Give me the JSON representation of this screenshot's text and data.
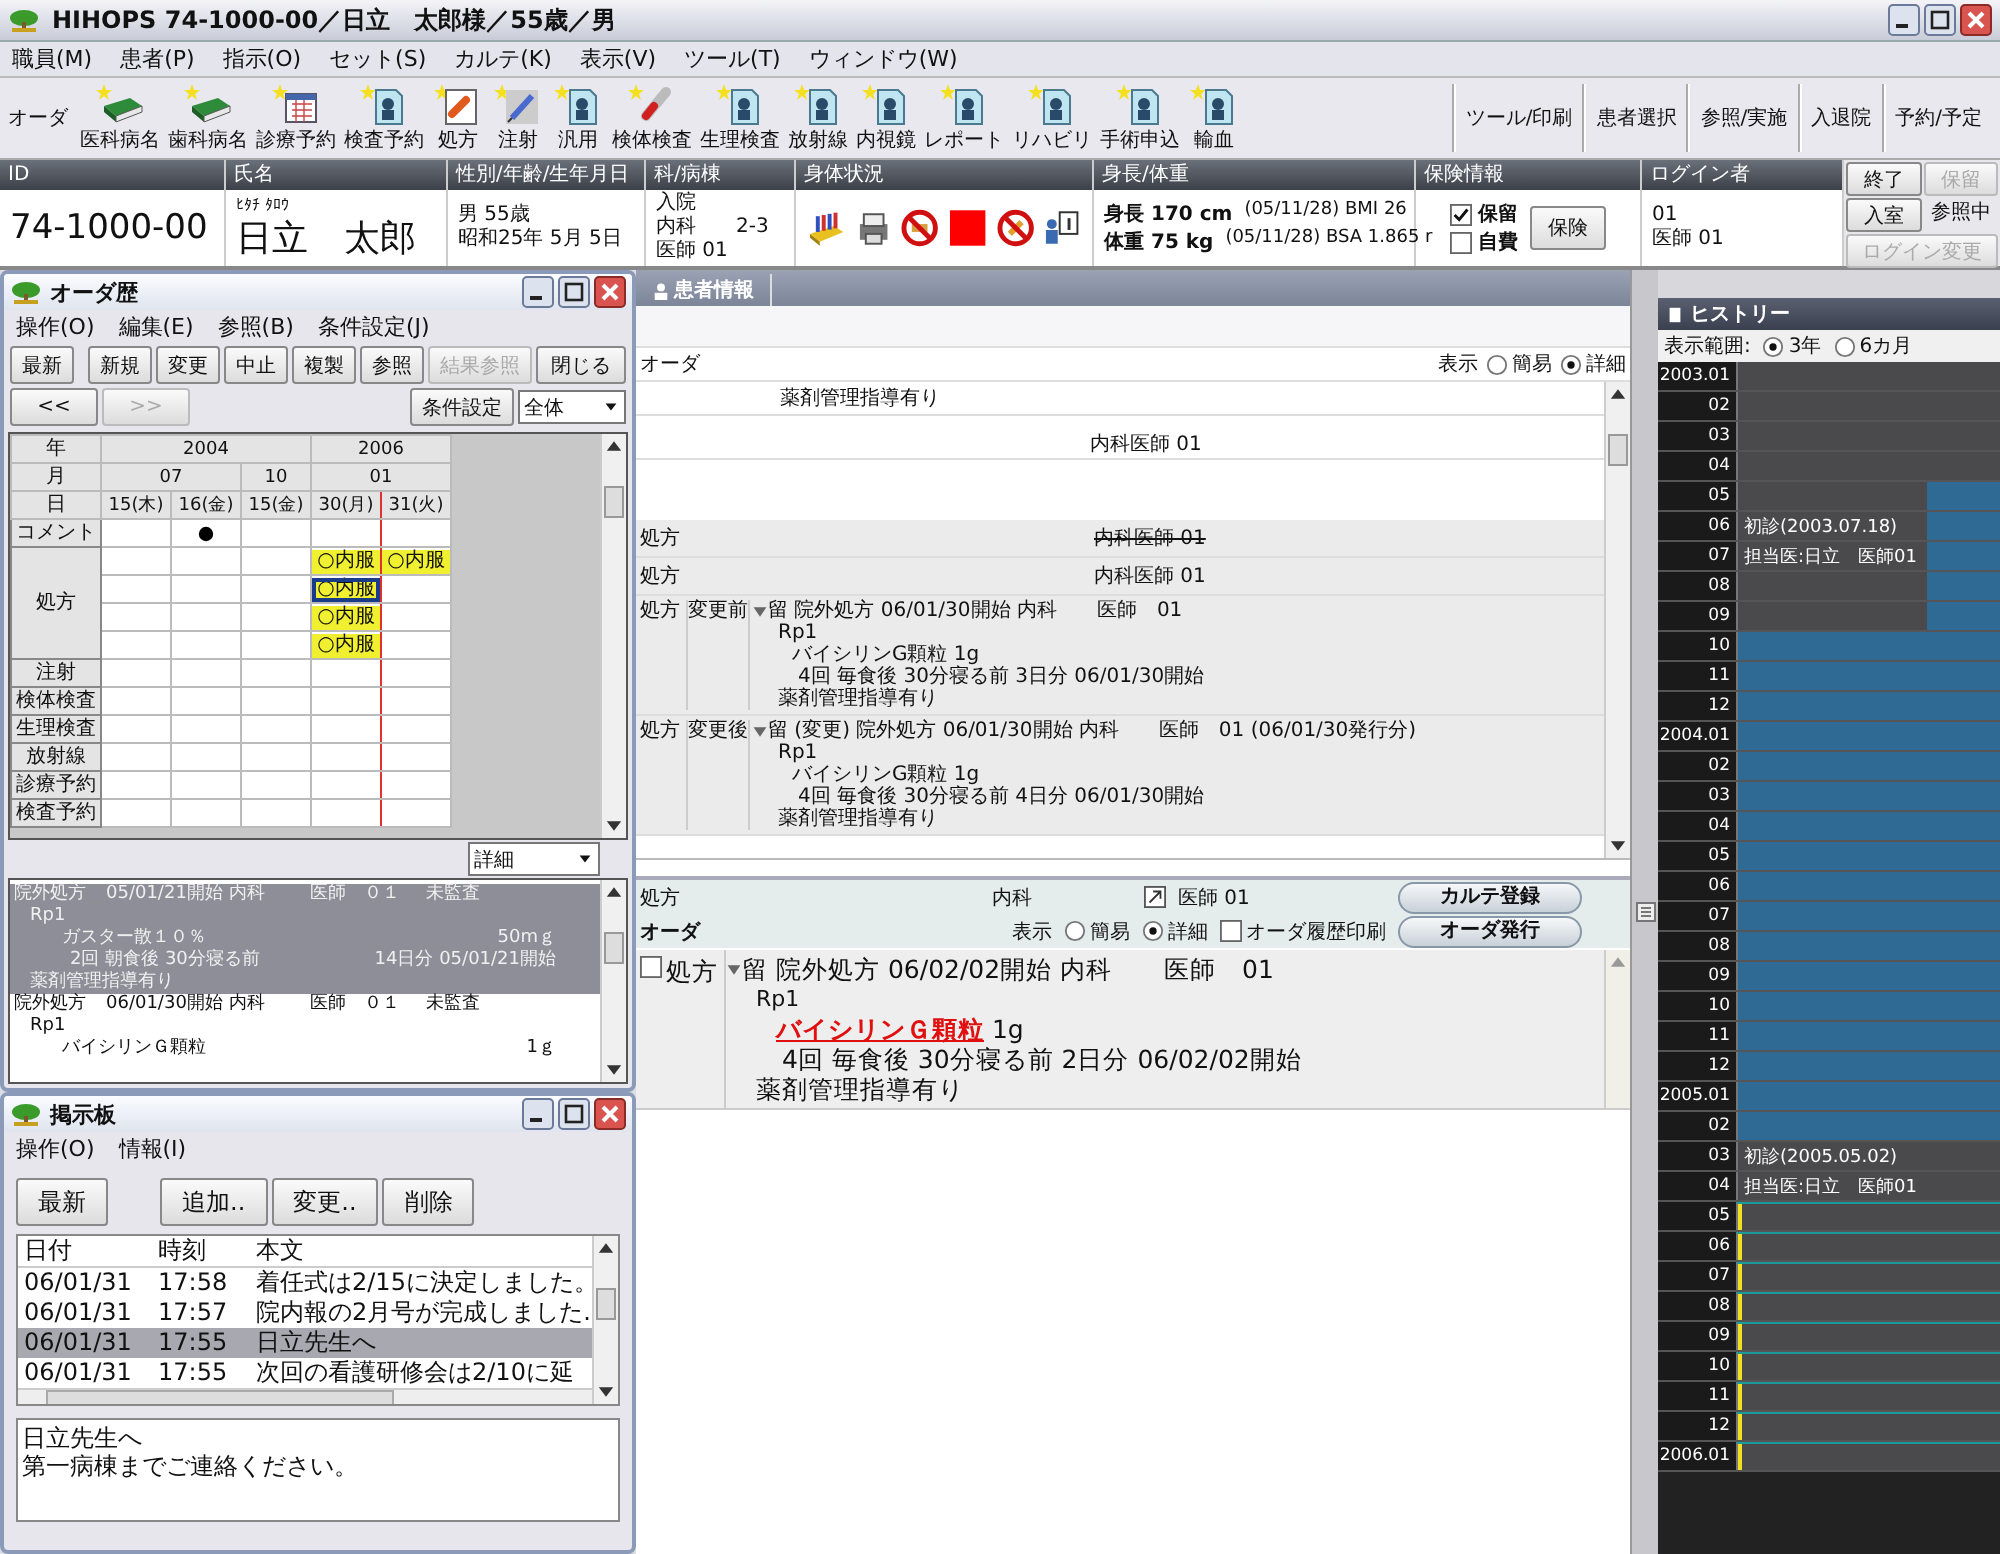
{
  "window": {
    "title": "HIHOPS 74-1000-00／日立　太郎様／55歳／男"
  },
  "menu": [
    "職員(M)",
    "患者(P)",
    "指示(O)",
    "セット(S)",
    "カルテ(K)",
    "表示(V)",
    "ツール(T)",
    "ウィンドウ(W)"
  ],
  "toolbar": {
    "label": "オーダ",
    "items": [
      "医科病名",
      "歯科病名",
      "診療予約",
      "検査予約",
      "処方",
      "注射",
      "汎用",
      "検体検査",
      "生理検査",
      "放射線",
      "内視鏡",
      "レポート",
      "リハビリ",
      "手術申込",
      "輸血"
    ],
    "buttons": [
      "ツール/印刷",
      "患者選択",
      "参照/実施",
      "入退院",
      "予約/予定"
    ]
  },
  "patient": {
    "id": {
      "heading": "ID",
      "value": "74-1000-00"
    },
    "name": {
      "heading": "氏名",
      "kana": "ﾋﾀﾁ ﾀﾛｳ",
      "value": "日立　太郎"
    },
    "profile": {
      "heading": "性別/年齢/生年月日",
      "lines": [
        "男 55歳",
        "昭和25年 5月 5日"
      ]
    },
    "ward": {
      "heading": "科/病棟",
      "lines": [
        "入院",
        "内科　　2-3",
        "医師 01"
      ]
    },
    "status": {
      "heading": "身体状況"
    },
    "body": {
      "heading": "身長/体重",
      "rows": [
        {
          "label": "身長 170 cm",
          "detail": "(05/11/28) BMI 26"
        },
        {
          "label": "体重 75 kg",
          "detail": "(05/11/28) BSA 1.865 r"
        }
      ]
    },
    "insurance": {
      "heading": "保険情報",
      "checks": [
        {
          "label": "保留",
          "checked": true
        },
        {
          "label": "自費",
          "checked": false
        }
      ],
      "button": "保険"
    },
    "login": {
      "heading": "ログイン者",
      "lines": [
        "01",
        "医師 01"
      ],
      "buttons": [
        {
          "label": "終了",
          "kind": "button",
          "disabled": false
        },
        {
          "label": "保留",
          "kind": "button",
          "disabled": true
        },
        {
          "label": "入室",
          "kind": "button",
          "disabled": false
        },
        {
          "label": "参照中",
          "kind": "text",
          "disabled": false
        },
        {
          "label": "ログイン変更",
          "kind": "button",
          "disabled": true
        }
      ]
    }
  },
  "order_history": {
    "title": "オーダ歴",
    "menu": [
      "操作(O)",
      "編集(E)",
      "参照(B)",
      "条件設定(J)"
    ],
    "buttons": [
      {
        "label": "最新",
        "disabled": false
      },
      {
        "label": "新規",
        "disabled": false
      },
      {
        "label": "変更",
        "disabled": false
      },
      {
        "label": "中止",
        "disabled": false
      },
      {
        "label": "複製",
        "disabled": false
      },
      {
        "label": "参照",
        "disabled": false
      },
      {
        "label": "結果参照",
        "disabled": true
      },
      {
        "label": "閉じる",
        "disabled": false
      }
    ],
    "nav": [
      {
        "label": "<<",
        "disabled": false
      },
      {
        "label": ">>",
        "disabled": true
      }
    ],
    "filter_button": "条件設定",
    "filter": "全体",
    "grid": {
      "header_labels": [
        "年",
        "月",
        "日"
      ],
      "years": [
        {
          "label": "2004",
          "months": [
            {
              "label": "07",
              "days": [
                {
                  "label": "15(木)",
                  "marked": false
                },
                {
                  "label": "16(金)",
                  "marked": false
                }
              ]
            },
            {
              "label": "10",
              "days": [
                {
                  "label": "15(金)",
                  "marked": false
                }
              ]
            }
          ]
        },
        {
          "label": "2006",
          "months": [
            {
              "label": "01",
              "days": [
                {
                  "label": "30(月)",
                  "marked": true
                },
                {
                  "label": "31(火)",
                  "marked": false
                }
              ]
            }
          ]
        }
      ],
      "rows": [
        {
          "label": "コメント",
          "lines": [
            [
              {
                "kind": "empty"
              },
              {
                "kind": "dot"
              },
              {
                "kind": "empty"
              },
              {
                "kind": "empty"
              },
              {
                "kind": "empty"
              }
            ]
          ]
        },
        {
          "label": "処方",
          "lines": [
            [
              {
                "kind": "empty"
              },
              {
                "kind": "empty"
              },
              {
                "kind": "empty"
              },
              {
                "kind": "order",
                "text": "○内服",
                "selected": false
              },
              {
                "kind": "order",
                "text": "○内服",
                "selected": false
              }
            ],
            [
              {
                "kind": "empty"
              },
              {
                "kind": "empty"
              },
              {
                "kind": "empty"
              },
              {
                "kind": "order",
                "text": "○内服",
                "selected": true
              },
              {
                "kind": "empty"
              }
            ],
            [
              {
                "kind": "empty"
              },
              {
                "kind": "empty"
              },
              {
                "kind": "empty"
              },
              {
                "kind": "order",
                "text": "○内服",
                "selected": false
              },
              {
                "kind": "empty"
              }
            ],
            [
              {
                "kind": "empty"
              },
              {
                "kind": "empty"
              },
              {
                "kind": "empty"
              },
              {
                "kind": "order",
                "text": "○内服",
                "selected": false
              },
              {
                "kind": "empty"
              }
            ]
          ]
        },
        {
          "label": "注射",
          "lines": [
            [
              {
                "kind": "empty"
              },
              {
                "kind": "empty"
              },
              {
                "kind": "empty"
              },
              {
                "kind": "empty"
              },
              {
                "kind": "empty"
              }
            ]
          ]
        },
        {
          "label": "検体検査",
          "lines": [
            [
              {
                "kind": "empty"
              },
              {
                "kind": "empty"
              },
              {
                "kind": "empty"
              },
              {
                "kind": "empty"
              },
              {
                "kind": "empty"
              }
            ]
          ]
        },
        {
          "label": "生理検査",
          "lines": [
            [
              {
                "kind": "empty"
              },
              {
                "kind": "empty"
              },
              {
                "kind": "empty"
              },
              {
                "kind": "empty"
              },
              {
                "kind": "empty"
              }
            ]
          ]
        },
        {
          "label": "放射線",
          "lines": [
            [
              {
                "kind": "empty"
              },
              {
                "kind": "empty"
              },
              {
                "kind": "empty"
              },
              {
                "kind": "empty"
              },
              {
                "kind": "empty"
              }
            ]
          ]
        },
        {
          "label": "診療予約",
          "lines": [
            [
              {
                "kind": "empty"
              },
              {
                "kind": "empty"
              },
              {
                "kind": "empty"
              },
              {
                "kind": "empty"
              },
              {
                "kind": "empty"
              }
            ]
          ]
        },
        {
          "label": "検査予約",
          "lines": [
            [
              {
                "kind": "empty"
              },
              {
                "kind": "empty"
              },
              {
                "kind": "empty"
              },
              {
                "kind": "empty"
              },
              {
                "kind": "empty"
              }
            ]
          ]
        }
      ]
    },
    "view": "詳細",
    "details": [
      {
        "selected": true,
        "lines": [
          {
            "kind": "head",
            "cells": [
              "院外処方",
              "05/01/21開始 内科",
              "医師　０１",
              "未監査"
            ]
          },
          {
            "kind": "rp",
            "text": "Rp1"
          },
          {
            "kind": "drug",
            "text": "ガスター散１０％",
            "aside": "50mｇ"
          },
          {
            "kind": "usage",
            "text": "2回 朝食後 30分寝る前",
            "aside": "14日分 05/01/21開始"
          },
          {
            "kind": "note",
            "text": "薬剤管理指導有り"
          }
        ]
      },
      {
        "selected": false,
        "lines": [
          {
            "kind": "head",
            "cells": [
              "院外処方",
              "06/01/30開始 内科",
              "医師　０１",
              "未監査"
            ]
          },
          {
            "kind": "rp",
            "text": "Rp1"
          },
          {
            "kind": "drug",
            "text": "バイシリンＧ顆粒",
            "aside": "1ｇ"
          }
        ]
      }
    ]
  },
  "bulletin": {
    "title": "掲示板",
    "menu": [
      "操作(O)",
      "情報(I)"
    ],
    "buttons": [
      "最新",
      "追加..",
      "変更..",
      "削除"
    ],
    "columns": [
      "日付",
      "時刻",
      "本文"
    ],
    "rows": [
      {
        "date": "06/01/31",
        "time": "17:58",
        "text": "着任式は2/15に決定しました。",
        "selected": false
      },
      {
        "date": "06/01/31",
        "time": "17:57",
        "text": "院内報の2月号が完成しました.",
        "selected": false
      },
      {
        "date": "06/01/31",
        "time": "17:55",
        "text": "日立先生へ",
        "selected": true
      },
      {
        "date": "06/01/31",
        "time": "17:55",
        "text": "次回の看護研修会は2/10に延",
        "selected": false
      }
    ],
    "message": [
      "日立先生へ",
      "第一病棟までご連絡ください。"
    ]
  },
  "patient_info": {
    "tab": "患者情報",
    "order_label": "オーダ",
    "view": {
      "label": "表示",
      "options": [
        {
          "label": "簡易",
          "selected": false
        },
        {
          "label": "詳細",
          "selected": true
        }
      ]
    },
    "entries": [
      {
        "kind": "note",
        "text": "薬剤管理指導有り"
      },
      {
        "kind": "doctor",
        "text": "内科医師 01"
      },
      {
        "kind": "summary",
        "label": "処方",
        "text": "内科医師 01",
        "struck": true
      },
      {
        "kind": "summary",
        "label": "処方",
        "text": "内科医師 01",
        "struck": false
      },
      {
        "kind": "order",
        "label": "処方",
        "status": "変更前",
        "head": "留 院外処方 06/01/30開始 内科　　医師　01",
        "lines": [
          {
            "kind": "rp",
            "text": "Rp1"
          },
          {
            "kind": "drug",
            "text": "バイシリンG顆粒 1g"
          },
          {
            "kind": "usage",
            "text": "4回 毎食後 30分寝る前 3日分 06/01/30開始"
          },
          {
            "kind": "note",
            "text": "薬剤管理指導有り"
          }
        ]
      },
      {
        "kind": "order",
        "label": "処方",
        "status": "変更後",
        "head": "留 (変更) 院外処方 06/01/30開始 内科　　医師　01 (06/01/30発行分)",
        "lines": [
          {
            "kind": "rp",
            "text": "Rp1"
          },
          {
            "kind": "drug",
            "text": "バイシリンG顆粒 1g"
          },
          {
            "kind": "usage",
            "text": "4回 毎食後 30分寝る前 4日分 06/01/30開始"
          },
          {
            "kind": "note",
            "text": "薬剤管理指導有り"
          }
        ]
      }
    ]
  },
  "order_entry": {
    "category": "処方",
    "department": "内科",
    "doctor": "医師 01",
    "register_button": "カルテ登録",
    "order_label": "オーダ",
    "view": {
      "label": "表示",
      "options": [
        {
          "label": "簡易",
          "selected": false
        },
        {
          "label": "詳細",
          "selected": true
        }
      ]
    },
    "print": {
      "label": "オーダ履歴印刷",
      "checked": false
    },
    "issue_button": "オーダ発行",
    "order": {
      "checked": false,
      "label": "処方",
      "head": "留 院外処方 06/02/02開始 内科　　医師　01",
      "lines": [
        {
          "kind": "rp",
          "text": "Rp1"
        },
        {
          "kind": "drug",
          "text": "バイシリンＧ顆粒",
          "amount": "1g"
        },
        {
          "kind": "usage",
          "text": "4回 毎食後 30分寝る前 2日分 06/02/02開始"
        },
        {
          "kind": "note",
          "text": "薬剤管理指導有り"
        }
      ]
    }
  },
  "history": {
    "title": "ヒストリー",
    "range": {
      "label": "表示範囲:",
      "options": [
        {
          "label": "3年",
          "selected": true
        },
        {
          "label": "6カ月",
          "selected": false
        }
      ]
    },
    "rows": [
      {
        "label": "2003.01",
        "kind": "empty"
      },
      {
        "label": "02",
        "kind": "empty"
      },
      {
        "label": "03",
        "kind": "empty"
      },
      {
        "label": "04",
        "kind": "empty"
      },
      {
        "label": "05",
        "kind": "partial"
      },
      {
        "label": "06",
        "kind": "partial",
        "note": "初診(2003.07.18)"
      },
      {
        "label": "07",
        "kind": "partial",
        "note": "担当医:日立　医師01"
      },
      {
        "label": "08",
        "kind": "partial"
      },
      {
        "label": "09",
        "kind": "partial"
      },
      {
        "label": "10",
        "kind": "stay"
      },
      {
        "label": "11",
        "kind": "stay"
      },
      {
        "label": "12",
        "kind": "stay"
      },
      {
        "label": "2004.01",
        "kind": "stay"
      },
      {
        "label": "02",
        "kind": "stay"
      },
      {
        "label": "03",
        "kind": "stay"
      },
      {
        "label": "04",
        "kind": "stay"
      },
      {
        "label": "05",
        "kind": "stay"
      },
      {
        "label": "06",
        "kind": "stay"
      },
      {
        "label": "07",
        "kind": "stay"
      },
      {
        "label": "08",
        "kind": "stay"
      },
      {
        "label": "09",
        "kind": "stay"
      },
      {
        "label": "10",
        "kind": "stay"
      },
      {
        "label": "11",
        "kind": "stay"
      },
      {
        "label": "12",
        "kind": "stay"
      },
      {
        "label": "2005.01",
        "kind": "stay"
      },
      {
        "label": "02",
        "kind": "stay"
      },
      {
        "label": "03",
        "kind": "empty",
        "note": "初診(2005.05.02)"
      },
      {
        "label": "04",
        "kind": "empty",
        "note": "担当医:日立　医師01"
      },
      {
        "label": "05",
        "kind": "current"
      },
      {
        "label": "06",
        "kind": "current"
      },
      {
        "label": "07",
        "kind": "current"
      },
      {
        "label": "08",
        "kind": "current"
      },
      {
        "label": "09",
        "kind": "current"
      },
      {
        "label": "10",
        "kind": "current"
      },
      {
        "label": "11",
        "kind": "current"
      },
      {
        "label": "12",
        "kind": "current"
      },
      {
        "label": "2006.01",
        "kind": "current"
      }
    ]
  }
}
